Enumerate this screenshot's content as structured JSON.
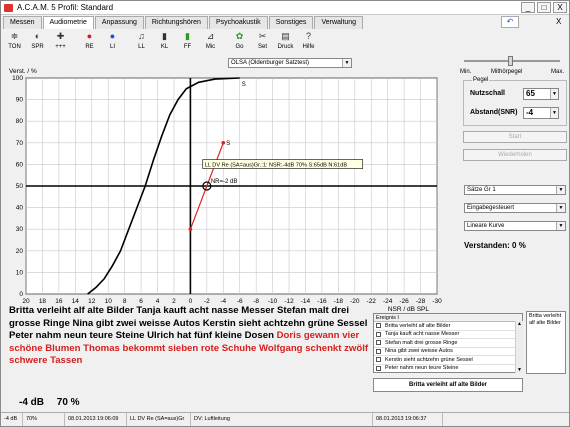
{
  "window": {
    "title": "A.C.A.M. 5 Profil: Standard",
    "min_label": "_",
    "max_label": "□",
    "close_label": "X"
  },
  "tabs": [
    "Messen",
    "Audiometrie",
    "Anpassung",
    "Richtungshören",
    "Psychoakustik",
    "Sonstiges",
    "Verwaltung"
  ],
  "tabs_close": "X",
  "toolbar": [
    {
      "label": "TON",
      "icon": "≑",
      "color": "#333"
    },
    {
      "label": "SPR",
      "icon": "◐",
      "color": "#333"
    },
    {
      "label": "+++",
      "icon": "✚",
      "color": "#333"
    },
    {
      "label": "RE",
      "icon": "●",
      "color": "#d21e1e"
    },
    {
      "label": "LI",
      "icon": "●",
      "color": "#1e4ed2"
    },
    {
      "label": "LL",
      "icon": "♫",
      "color": "#333"
    },
    {
      "label": "KL",
      "icon": "▮",
      "color": "#333"
    },
    {
      "label": "FF",
      "icon": "▮",
      "color": "#2a9a2a"
    },
    {
      "label": "Mic",
      "icon": "⊿",
      "color": "#333"
    },
    {
      "label": "Go",
      "icon": "✿",
      "color": "#2a9a2a"
    },
    {
      "label": "Set",
      "icon": "✂",
      "color": "#333"
    },
    {
      "label": "Druck",
      "icon": "▤",
      "color": "#333"
    },
    {
      "label": "Hilfe",
      "icon": "?",
      "color": "#333"
    }
  ],
  "test_select": "OLSA (Oldenburger Satztest)",
  "right": {
    "slider_min": "Min.",
    "slider_mid": "Mithörpegel",
    "slider_max": "Max.",
    "pegel_title": "Pegel",
    "nutzschall_label": "Nutzschall",
    "nutzschall_value": "65",
    "abstand_label": "Abstand(SNR)",
    "abstand_value": "-4",
    "start_label": "Start",
    "repeat_label": "Wiederholen",
    "saetze_select": "Sätze Gr 1",
    "eingabe_select": "Eingabegesteuert",
    "kurve_select": "Lineare Kurve",
    "verstanden": "Verstanden: 0 %"
  },
  "sentences": {
    "black": "Britta verleiht alf alte Bilder Tanja kauft acht nasse Messer Stefan malt drei grosse Ringe Nina gibt zwei weisse Autos Kerstin sieht achtzehn grüne Sessel Peter nahm neun teure Steine Ulrich hat fünf kleine Dosen",
    "red": "Doris gewann vier schöne Blumen Thomas bekommt sieben rote Schuhe Wolfgang schenkt zwölf schwere Tassen"
  },
  "result": {
    "db": "-4 dB",
    "percent": "70 %"
  },
  "events": {
    "header": "Ereignis I",
    "items": [
      "Britta verleiht alf alte Bilder",
      "Tanja kauft acht nasse Messer",
      "Stefan malt drei grosse Ringe",
      "Nina gibt zwei weisse Autos",
      "Kerstin sieht achtzehn grüne Sessel",
      "Peter nahm neun teure Steine"
    ]
  },
  "side_list": "Britta verleiht alf alte Bilder",
  "current_sentence": "Britta verleiht alf alte Bilder",
  "status": [
    "-4 dB",
    "70%",
    "08.01.2013 19:06:09",
    "LL DV Re (SA=aus)Gr",
    "DV: Luftleitung",
    "08.01.2013 19:06:37"
  ],
  "chart_data": {
    "type": "line",
    "ylabel": "Verst. / %",
    "xlabel": "NSR / dB SPL",
    "ylim": [
      0,
      100
    ],
    "xlim": [
      20,
      -30
    ],
    "xticks": [
      20,
      18,
      16,
      14,
      12,
      10,
      8,
      6,
      4,
      2,
      0,
      -2,
      -4,
      -6,
      -8,
      -10,
      -12,
      -14,
      -16,
      -18,
      -20,
      -22,
      -24,
      -26,
      -28,
      -30
    ],
    "yticks": [
      0,
      10,
      20,
      30,
      40,
      50,
      60,
      70,
      80,
      90,
      100
    ],
    "curve_label": "S",
    "curve": [
      [
        12.5,
        0
      ],
      [
        11.5,
        3
      ],
      [
        10.5,
        7
      ],
      [
        9.5,
        13
      ],
      [
        8.5,
        20
      ],
      [
        7.5,
        30
      ],
      [
        6.5,
        40
      ],
      [
        5.5,
        50
      ],
      [
        4.5,
        62
      ],
      [
        3.5,
        73
      ],
      [
        2.5,
        83
      ],
      [
        1.5,
        90
      ],
      [
        0.5,
        95
      ],
      [
        -1,
        98
      ],
      [
        -3,
        99.5
      ],
      [
        -6,
        100
      ]
    ],
    "measure_label": "S",
    "measure": [
      [
        0,
        30
      ],
      [
        -4,
        70
      ]
    ],
    "marker_label": "NR=-2 dB",
    "marker": [
      -2,
      50
    ],
    "tooltip": "LL DV Re (SA=aus)Gr.:1: NSR:-4dB 70% S:65dB N:61dB",
    "curve_color": "#000000",
    "measure_color": "#e02020"
  }
}
